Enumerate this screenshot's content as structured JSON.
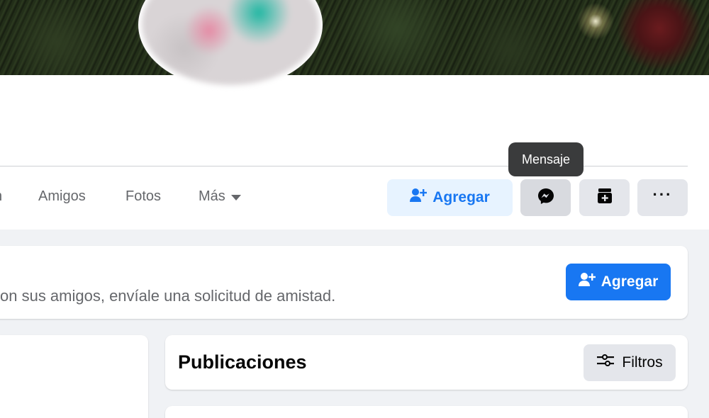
{
  "profile": {
    "cover": {
      "icon": "cover-photo"
    },
    "avatar": {
      "icon": "profile-photo-blurred"
    }
  },
  "tabs": {
    "partial_label": "n",
    "friends_label": "Amigos",
    "photos_label": "Fotos",
    "more_label": "Más"
  },
  "actions": {
    "add_friend_label": "Agregar",
    "message_tooltip": "Mensaje",
    "message_icon": "messenger-icon",
    "package_icon": "package-icon",
    "more_icon": "more-horizontal-icon",
    "more_glyph": "···"
  },
  "suggestion_card": {
    "text": "on sus amigos, envíale una solicitud de amistad.",
    "add_friend_label": "Agregar"
  },
  "posts": {
    "title": "Publicaciones",
    "filters_label": "Filtros"
  },
  "colors": {
    "primary": "#1877f2",
    "primary_light": "#e7f3ff",
    "secondary_btn": "#e4e6eb",
    "page_bg": "#f0f2f5",
    "text_secondary": "#65676b"
  }
}
